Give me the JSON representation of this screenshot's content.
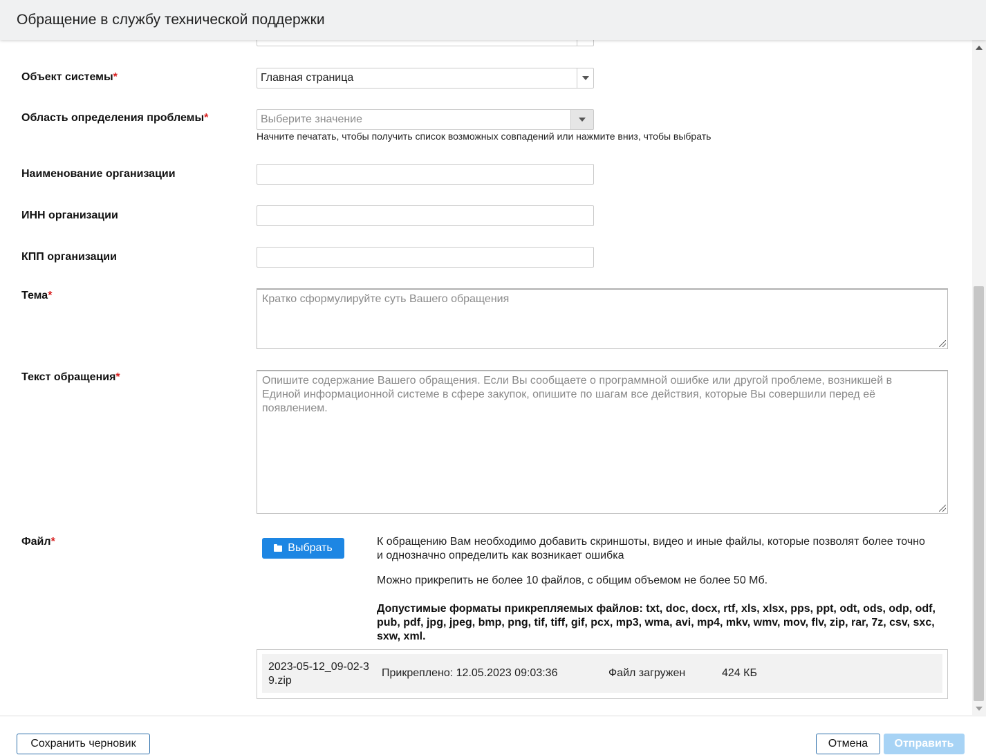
{
  "header": {
    "title": "Обращение в службу технической поддержки"
  },
  "form": {
    "object": {
      "label": "Объект системы",
      "value": "Главная страница"
    },
    "area": {
      "label": "Область определения проблемы",
      "placeholder": "Выберите значение",
      "hint": "Начните печатать, чтобы получить список возможных совпадений или нажмите вниз, чтобы выбрать"
    },
    "org_name": {
      "label": "Наименование организации",
      "value": ""
    },
    "inn": {
      "label": "ИНН организации",
      "value": ""
    },
    "kpp": {
      "label": "КПП организации",
      "value": ""
    },
    "topic": {
      "label": "Тема",
      "placeholder": "Кратко сформулируйте суть Вашего обращения"
    },
    "text": {
      "label": "Текст обращения",
      "placeholder": "Опишите содержание Вашего обращения. Если Вы сообщаете о программной ошибке или другой проблеме, возникшей в Единой информационной системе в сфере закупок, опишите по шагам все действия, которые Вы совершили перед её появлением."
    },
    "file": {
      "label": "Файл",
      "choose_label": "Выбрать",
      "info1": "К обращению Вам необходимо добавить скриншоты, видео и иные файлы, которые позволят более точно и однозначно определить как возникает ошибка",
      "info2": "Можно прикрепить не более 10 файлов, с общим объемом не более 50 Мб.",
      "info3": "Допустимые форматы прикрепляемых файлов: txt, doc, docx, rtf, xls, xlsx, pps, ppt, odt, ods, odp, odf, pub, pdf, jpg, jpeg, bmp, png, tif, tiff, gif, pcx, mp3, wma, avi, mp4, mkv, wmv, mov, flv, zip, rar, 7z, csv, sxc, sxw, xml.",
      "attached": {
        "name_line1": "2023-05-12_09-02-3",
        "name_line2": "9.zip",
        "attached_at": "Прикреплено: 12.05.2023 09:03:36",
        "status": "Файл загружен",
        "size": "424 КБ"
      }
    },
    "required_mark": "*"
  },
  "footer": {
    "save_draft": "Сохранить черновик",
    "cancel": "Отмена",
    "submit": "Отправить"
  },
  "colors": {
    "accent": "#1d86e3",
    "required": "#d81e1e",
    "submit_disabled": "#a7d3f5"
  },
  "icons": [
    "folder-icon",
    "chevron-down-icon",
    "scroll-up-icon",
    "scroll-down-icon"
  ]
}
